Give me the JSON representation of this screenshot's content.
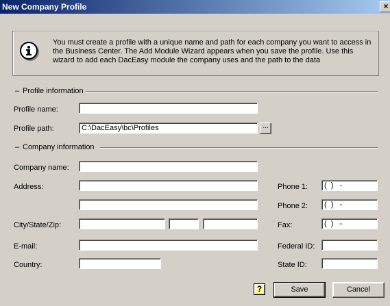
{
  "window": {
    "title": "New Company Profile",
    "close_glyph": "×"
  },
  "info": {
    "icon": "info-icon",
    "text": "You must create a profile with a unique name and path for each company you want to access in the Business Center. The Add Module Wizard appears when you save the profile. Use this wizard to add each DacEasy module the company uses and the path to the data"
  },
  "profile": {
    "group_label": "Profile information",
    "name_label": "Profile name:",
    "name_value": "",
    "path_label": "Profile path:",
    "path_value": "C:\\DacEasy\\bc\\Profiles",
    "browse_label": "..."
  },
  "company": {
    "group_label": "Company information",
    "name_label": "Company name:",
    "name_value": "",
    "address_label": "Address:",
    "address1_value": "",
    "address2_value": "",
    "city_label": "City/State/Zip:",
    "city_value": "",
    "state_value": "",
    "zip_value": "",
    "email_label": "E-mail:",
    "email_value": "",
    "country_label": "Country:",
    "country_value": "",
    "phone1_label": "Phone 1:",
    "phone1_value": "(  )   -",
    "phone2_label": "Phone 2:",
    "phone2_value": "(  )   -",
    "fax_label": "Fax:",
    "fax_value": "(  )   -",
    "federal_label": "Federal ID:",
    "federal_value": "",
    "state_id_label": "State ID:",
    "state_id_value": ""
  },
  "buttons": {
    "help": "?",
    "save": "Save",
    "cancel": "Cancel"
  },
  "group_dash": "–"
}
